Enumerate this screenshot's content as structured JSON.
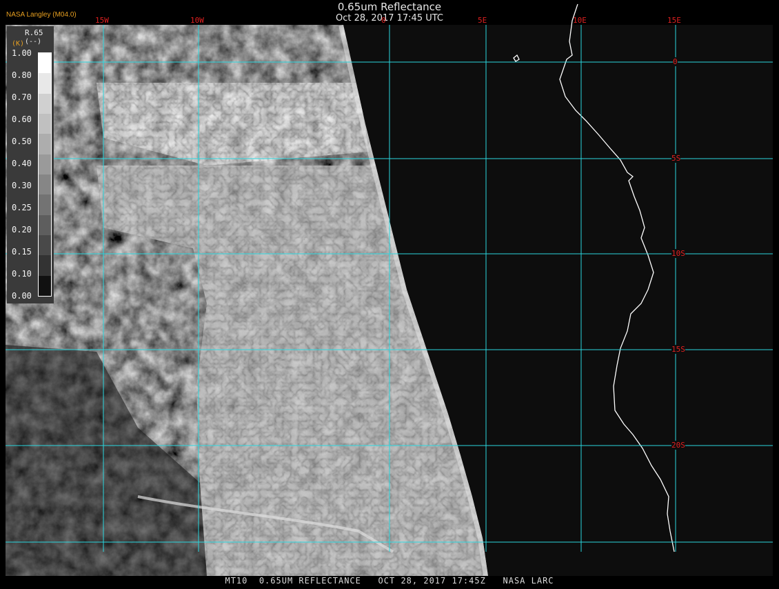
{
  "header": {
    "title": "0.65um Reflectance",
    "subtitle": "Oct 28, 2017 17:45 UTC",
    "agency": "NASA Langley (M04.0)"
  },
  "footer": {
    "text": "MT10  0.65UM REFLECTANCE   OCT 28, 2017 17:45Z   NASA LARC"
  },
  "legend": {
    "name": "R.65",
    "unit": "(--)",
    "kmark": "(K)",
    "ticks": [
      "1.00",
      "0.80",
      "0.70",
      "0.60",
      "0.50",
      "0.40",
      "0.30",
      "0.25",
      "0.20",
      "0.15",
      "0.10",
      "0.00"
    ],
    "colors": [
      "#ffffff",
      "#e8e8e8",
      "#d0d0d0",
      "#c0c0c0",
      "#adadad",
      "#9a9a9a",
      "#868686",
      "#737373",
      "#5e5e5e",
      "#494949",
      "#333333",
      "#111111"
    ]
  },
  "grid": {
    "longitudes": [
      "15W",
      "10W",
      "0",
      "5E",
      "10E",
      "15E"
    ],
    "latitudes": [
      "0",
      "5S",
      "10S",
      "15S",
      "20S"
    ],
    "line_color": "#2ad8e0",
    "label_color": "#e02020"
  },
  "map": {
    "coastline_color": "#ffffff",
    "background": "#0d0d0d"
  }
}
